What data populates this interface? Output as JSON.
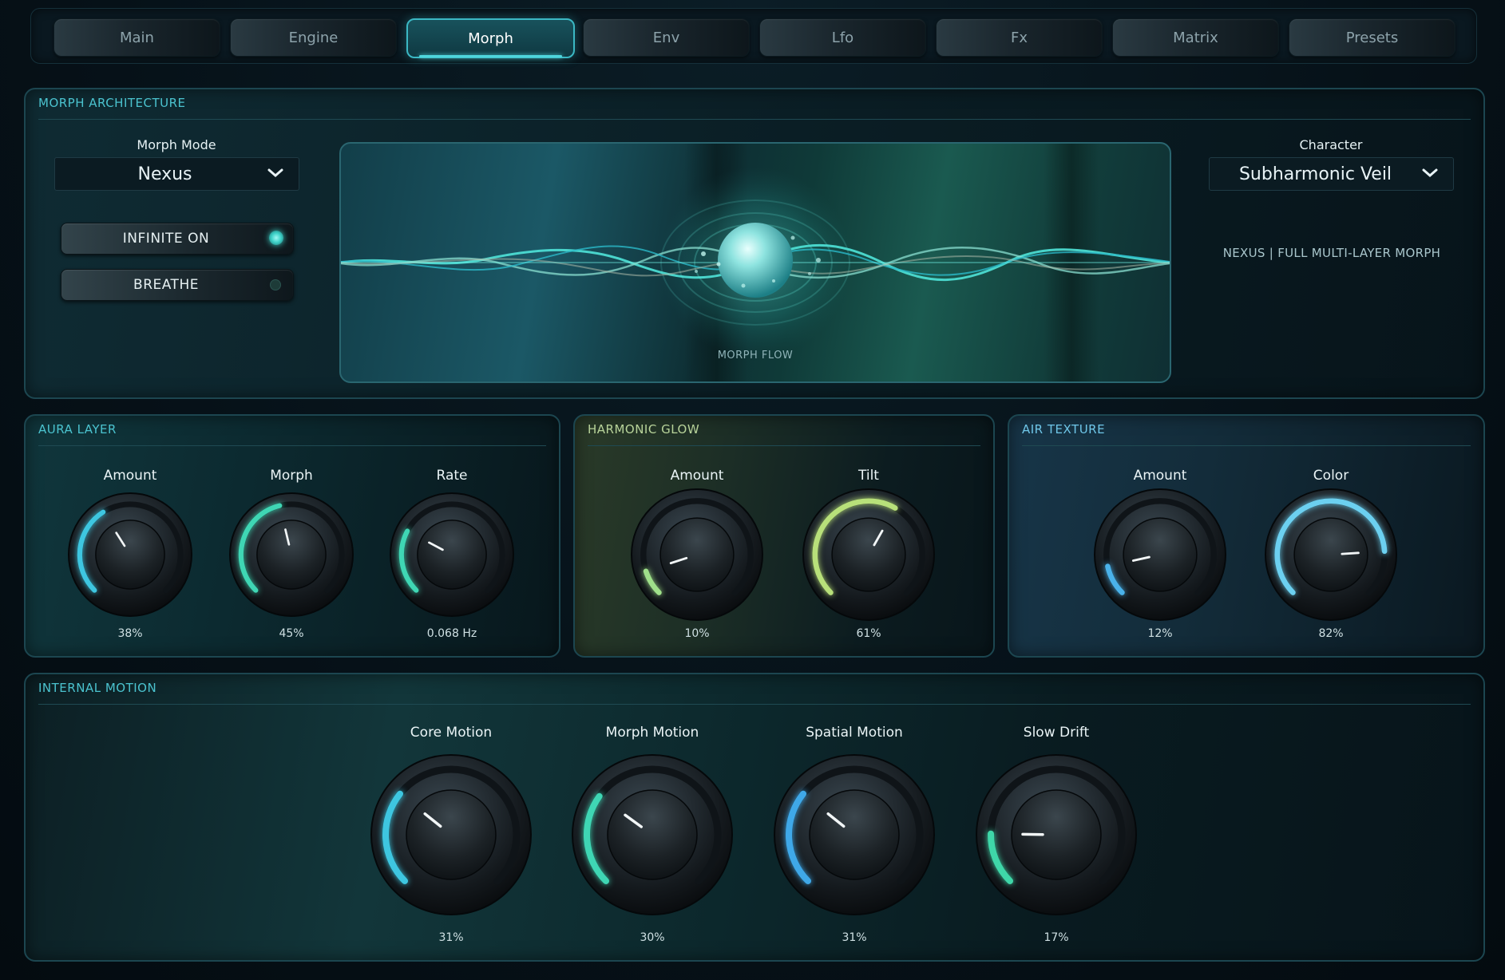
{
  "tabs": [
    {
      "label": "Main",
      "active": false
    },
    {
      "label": "Engine",
      "active": false
    },
    {
      "label": "Morph",
      "active": true
    },
    {
      "label": "Env",
      "active": false
    },
    {
      "label": "Lfo",
      "active": false
    },
    {
      "label": "Fx",
      "active": false
    },
    {
      "label": "Matrix",
      "active": false
    },
    {
      "label": "Presets",
      "active": false
    }
  ],
  "architecture": {
    "title": "MORPH ARCHITECTURE",
    "morph_mode_label": "Morph Mode",
    "morph_mode_value": "Nexus",
    "character_label": "Character",
    "character_value": "Subharmonic Veil",
    "character_description": "NEXUS | FULL MULTI-LAYER MORPH",
    "flow_label": "MORPH FLOW",
    "toggle_infinite": {
      "label": "INFINITE ON",
      "on": true
    },
    "toggle_breathe": {
      "label": "BREATHE",
      "on": false
    }
  },
  "aura": {
    "title": "AURA LAYER",
    "knobs": [
      {
        "label": "Amount",
        "value": "38%",
        "level": 0.38,
        "color": "#3ec6e0"
      },
      {
        "label": "Morph",
        "value": "45%",
        "level": 0.45,
        "color": "#3fd6b4"
      },
      {
        "label": "Rate",
        "value": "0.068 Hz",
        "level": 0.27,
        "color": "#3fd6b4"
      }
    ]
  },
  "harmonic": {
    "title": "HARMONIC GLOW",
    "knobs": [
      {
        "label": "Amount",
        "value": "10%",
        "level": 0.1,
        "color": "#9fe08a"
      },
      {
        "label": "Tilt",
        "value": "61%",
        "level": 0.61,
        "color": "#b8e07a"
      }
    ]
  },
  "air": {
    "title": "AIR TEXTURE",
    "knobs": [
      {
        "label": "Amount",
        "value": "12%",
        "level": 0.12,
        "color": "#4ab2ea"
      },
      {
        "label": "Color",
        "value": "82%",
        "level": 0.82,
        "color": "#6cd0f0"
      }
    ]
  },
  "motion": {
    "title": "INTERNAL MOTION",
    "knobs": [
      {
        "label": "Core Motion",
        "value": "31%",
        "level": 0.31,
        "color": "#3ec6e0"
      },
      {
        "label": "Morph Motion",
        "value": "30%",
        "level": 0.3,
        "color": "#3fd6b4"
      },
      {
        "label": "Spatial Motion",
        "value": "31%",
        "level": 0.31,
        "color": "#3fa8e8"
      },
      {
        "label": "Slow Drift",
        "value": "17%",
        "level": 0.17,
        "color": "#3fd6a8"
      }
    ]
  }
}
